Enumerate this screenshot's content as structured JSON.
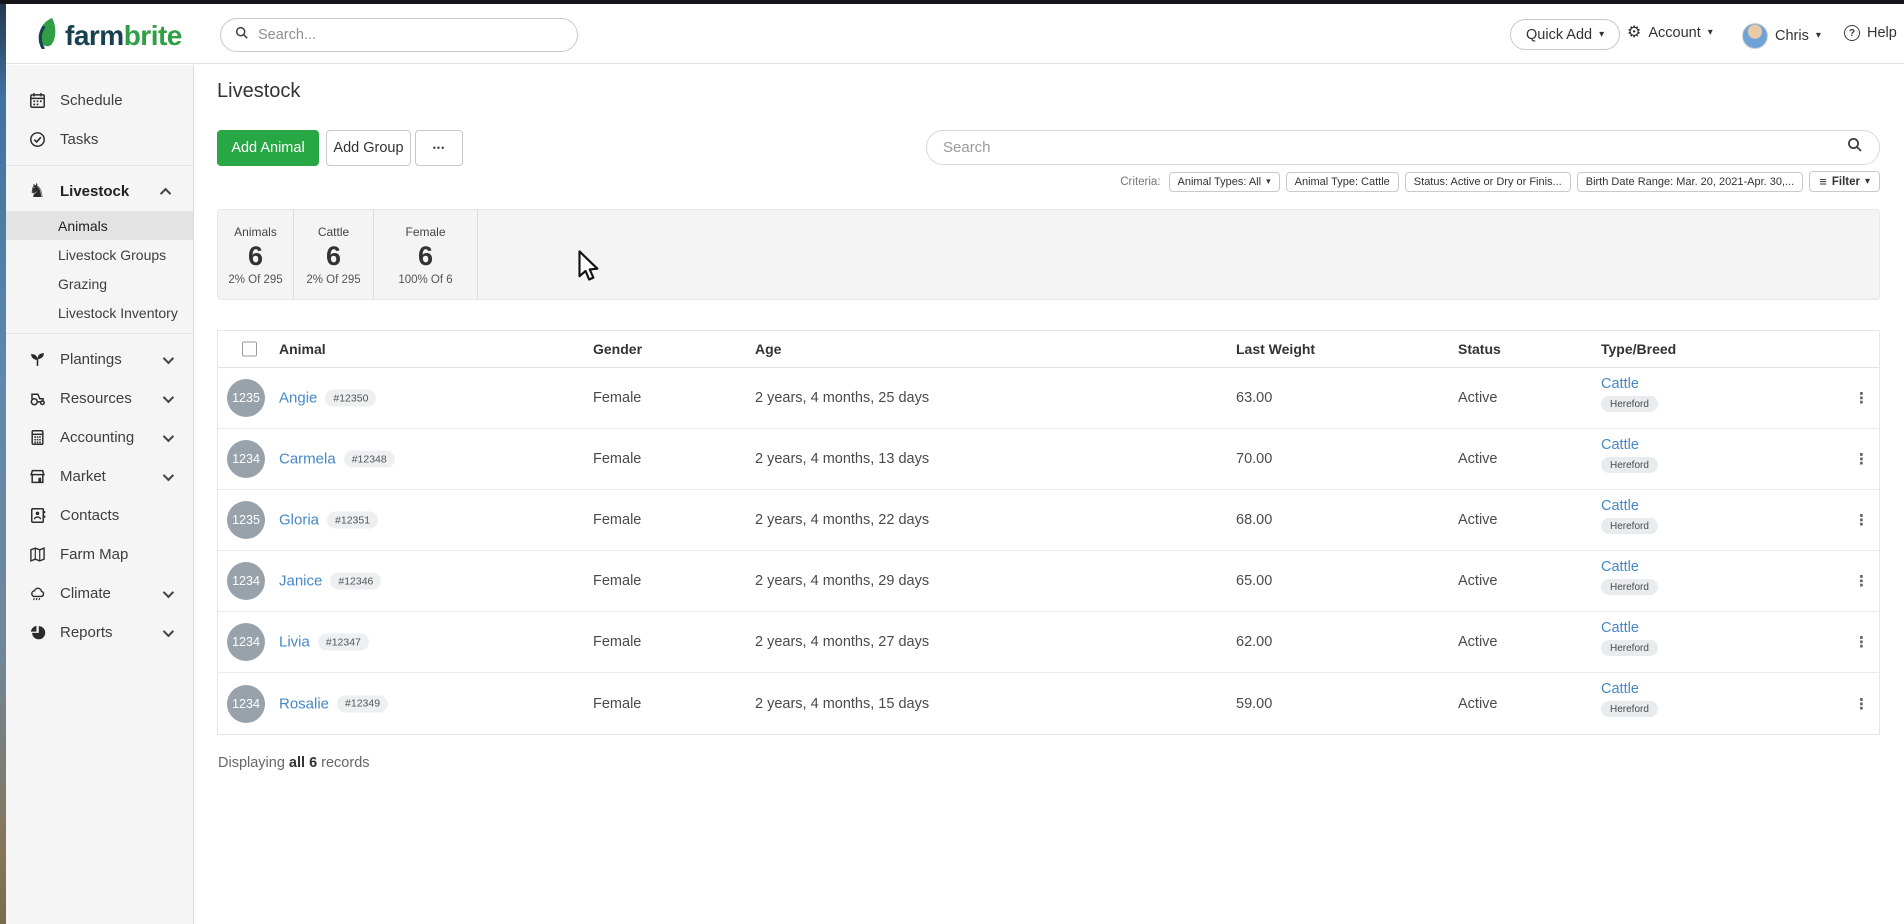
{
  "colors": {
    "accent_green": "#28a745",
    "link_blue": "#4688c7",
    "logo_dark": "#17414e",
    "logo_green": "#2f9e44"
  },
  "glyphs": {
    "caret_down": "▾",
    "knight": "♞",
    "gear": "⚙",
    "question": "?",
    "menu_dots_vertical": "⋮",
    "more_dots": "•••",
    "hamburger": "≡"
  },
  "header": {
    "logo_farm": "farm",
    "logo_brite": "brite",
    "search_placeholder": "Search...",
    "quick_add_label": "Quick Add",
    "account_label": "Account",
    "user_name": "Chris",
    "help_label": "Help"
  },
  "sidebar": {
    "items": [
      {
        "label": "Schedule",
        "icon": "calendar-icon"
      },
      {
        "label": "Tasks",
        "icon": "tasks-icon"
      },
      {
        "label": "Livestock",
        "icon": "livestock-icon",
        "chevron": "up",
        "expanded": true,
        "children": [
          "Animals",
          "Livestock Groups",
          "Grazing",
          "Livestock Inventory"
        ],
        "active_child": "Animals"
      },
      {
        "label": "Plantings",
        "icon": "plantings-icon",
        "chevron": "down"
      },
      {
        "label": "Resources",
        "icon": "resources-icon",
        "chevron": "down"
      },
      {
        "label": "Accounting",
        "icon": "accounting-icon",
        "chevron": "down"
      },
      {
        "label": "Market",
        "icon": "market-icon",
        "chevron": "down"
      },
      {
        "label": "Contacts",
        "icon": "contacts-icon"
      },
      {
        "label": "Farm Map",
        "icon": "farm-map-icon"
      },
      {
        "label": "Climate",
        "icon": "climate-icon",
        "chevron": "down"
      },
      {
        "label": "Reports",
        "icon": "reports-icon",
        "chevron": "down"
      }
    ]
  },
  "page": {
    "title": "Livestock",
    "add_animal_label": "Add Animal",
    "add_group_label": "Add Group",
    "search_placeholder": "Search",
    "criteria": {
      "label": "Criteria:",
      "chips": [
        {
          "label": "Animal Types: All",
          "caret": true
        },
        {
          "label": "Animal Type: Cattle"
        },
        {
          "label": "Status: Active or Dry or Finis..."
        },
        {
          "label": "Birth Date Range: Mar. 20, 2021-Apr. 30,..."
        }
      ],
      "filter_label": "Filter"
    }
  },
  "stats": [
    {
      "label": "Animals",
      "value": "6",
      "sub": "2% Of 295"
    },
    {
      "label": "Cattle",
      "value": "6",
      "sub": "2% Of 295"
    },
    {
      "label": "Female",
      "value": "6",
      "sub": "100% Of 6"
    }
  ],
  "table": {
    "columns": [
      "Animal",
      "Gender",
      "Age",
      "Last Weight",
      "Status",
      "Type/Breed"
    ],
    "rows": [
      {
        "avatar": "1235",
        "name": "Angie",
        "tag": "#12350",
        "gender": "Female",
        "age": "2 years, 4 months, 25 days",
        "weight": "63.00",
        "status": "Active",
        "type": "Cattle",
        "breed": "Hereford"
      },
      {
        "avatar": "1234",
        "name": "Carmela",
        "tag": "#12348",
        "gender": "Female",
        "age": "2 years, 4 months, 13 days",
        "weight": "70.00",
        "status": "Active",
        "type": "Cattle",
        "breed": "Hereford"
      },
      {
        "avatar": "1235",
        "name": "Gloria",
        "tag": "#12351",
        "gender": "Female",
        "age": "2 years, 4 months, 22 days",
        "weight": "68.00",
        "status": "Active",
        "type": "Cattle",
        "breed": "Hereford"
      },
      {
        "avatar": "1234",
        "name": "Janice",
        "tag": "#12346",
        "gender": "Female",
        "age": "2 years, 4 months, 29 days",
        "weight": "65.00",
        "status": "Active",
        "type": "Cattle",
        "breed": "Hereford"
      },
      {
        "avatar": "1234",
        "name": "Livia",
        "tag": "#12347",
        "gender": "Female",
        "age": "2 years, 4 months, 27 days",
        "weight": "62.00",
        "status": "Active",
        "type": "Cattle",
        "breed": "Hereford"
      },
      {
        "avatar": "1234",
        "name": "Rosalie",
        "tag": "#12349",
        "gender": "Female",
        "age": "2 years, 4 months, 15 days",
        "weight": "59.00",
        "status": "Active",
        "type": "Cattle",
        "breed": "Hereford"
      }
    ]
  },
  "footer": {
    "prefix": "Displaying ",
    "bold": "all 6",
    "suffix": " records"
  }
}
